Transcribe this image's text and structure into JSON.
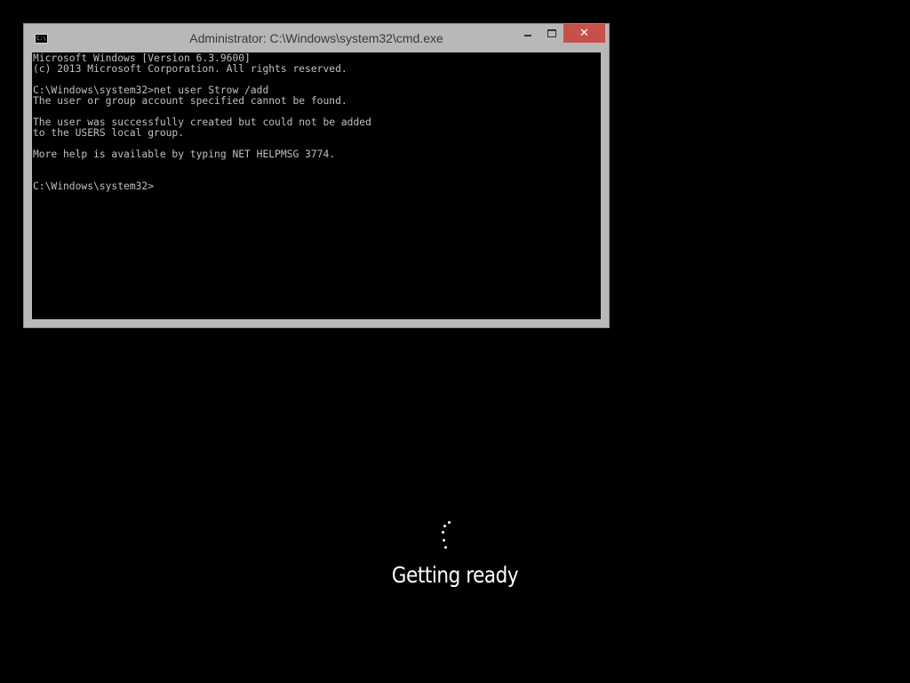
{
  "cmd_window": {
    "title": "Administrator: C:\\Windows\\system32\\cmd.exe",
    "icon": "cmd-icon",
    "icon_glyph": "C:\\.",
    "close_glyph": "✕",
    "console_lines": [
      "Microsoft Windows [Version 6.3.9600]",
      "(c) 2013 Microsoft Corporation. All rights reserved.",
      "",
      "C:\\Windows\\system32>net user Strow /add",
      "The user or group account specified cannot be found.",
      "",
      "The user was successfully created but could not be added",
      "to the USERS local group.",
      "",
      "More help is available by typing NET HELPMSG 3774.",
      "",
      "",
      "C:\\Windows\\system32>"
    ]
  },
  "boot_status": {
    "text": "Getting ready",
    "spinner_icon": "loading-spinner-icon"
  },
  "colors": {
    "background": "#000000",
    "window_frame": "#b8b8b8",
    "close_button": "#c7504a",
    "console_text": "#c0c0c0",
    "status_text": "#ffffff"
  }
}
